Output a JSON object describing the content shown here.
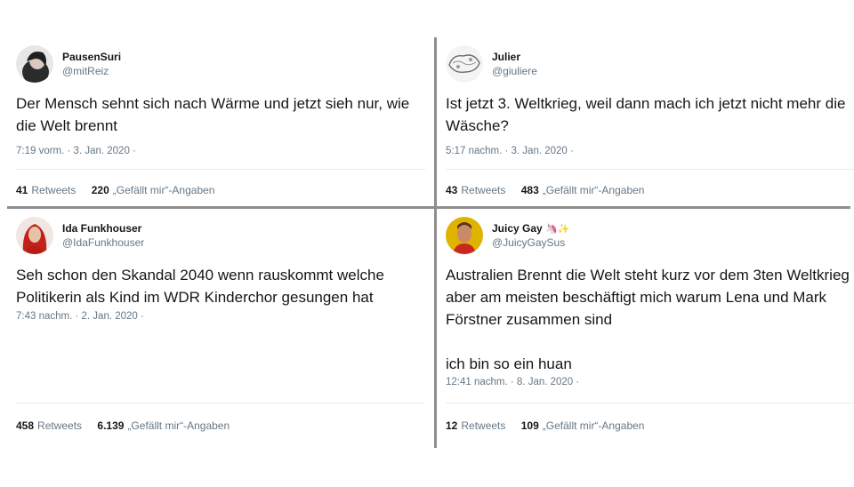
{
  "tweets": [
    {
      "name": "PausenSuri",
      "handle": "@mitReiz",
      "text": "Der Mensch sehnt sich nach Wärme und jetzt sieh nur, wie die Welt brennt",
      "time": "7:19 vorm. · 3. Jan. 2020 ·",
      "retweets": "41",
      "retweets_label": "Retweets",
      "likes": "220",
      "likes_label": "„Gefällt mir“-Angaben"
    },
    {
      "name": "Julier",
      "handle": "@giuliere",
      "text": "Ist jetzt 3. Weltkrieg, weil dann mach ich jetzt nicht mehr die Wäsche?",
      "time": "5:17 nachm. · 3. Jan. 2020 ·",
      "retweets": "43",
      "retweets_label": "Retweets",
      "likes": "483",
      "likes_label": "„Gefällt mir“-Angaben"
    },
    {
      "name": "Ida Funkhouser",
      "handle": "@IdaFunkhouser",
      "text": "Seh schon den Skandal 2040 wenn rauskommt welche Politikerin als Kind im WDR Kinderchor gesungen hat",
      "time": "7:43 nachm. · 2. Jan. 2020 ·",
      "retweets": "458",
      "retweets_label": "Retweets",
      "likes": "6.139",
      "likes_label": "„Gefällt mir“-Angaben"
    },
    {
      "name": "Juicy Gay",
      "name_emoji": "🦄✨",
      "handle": "@JuicyGaySus",
      "text": "Australien Brennt die Welt steht kurz vor dem 3ten Weltkrieg aber am meisten beschäftigt mich warum Lena und Mark Förstner zusammen sind\n\nich bin so ein huan",
      "time": "12:41 nachm. · 8. Jan. 2020 ·",
      "retweets": "12",
      "retweets_label": "Retweets",
      "likes": "109",
      "likes_label": "„Gefällt mir“-Angaben"
    }
  ],
  "colors": {
    "divider": "#8e8e8e",
    "muted": "#657786",
    "text": "#14171a"
  }
}
